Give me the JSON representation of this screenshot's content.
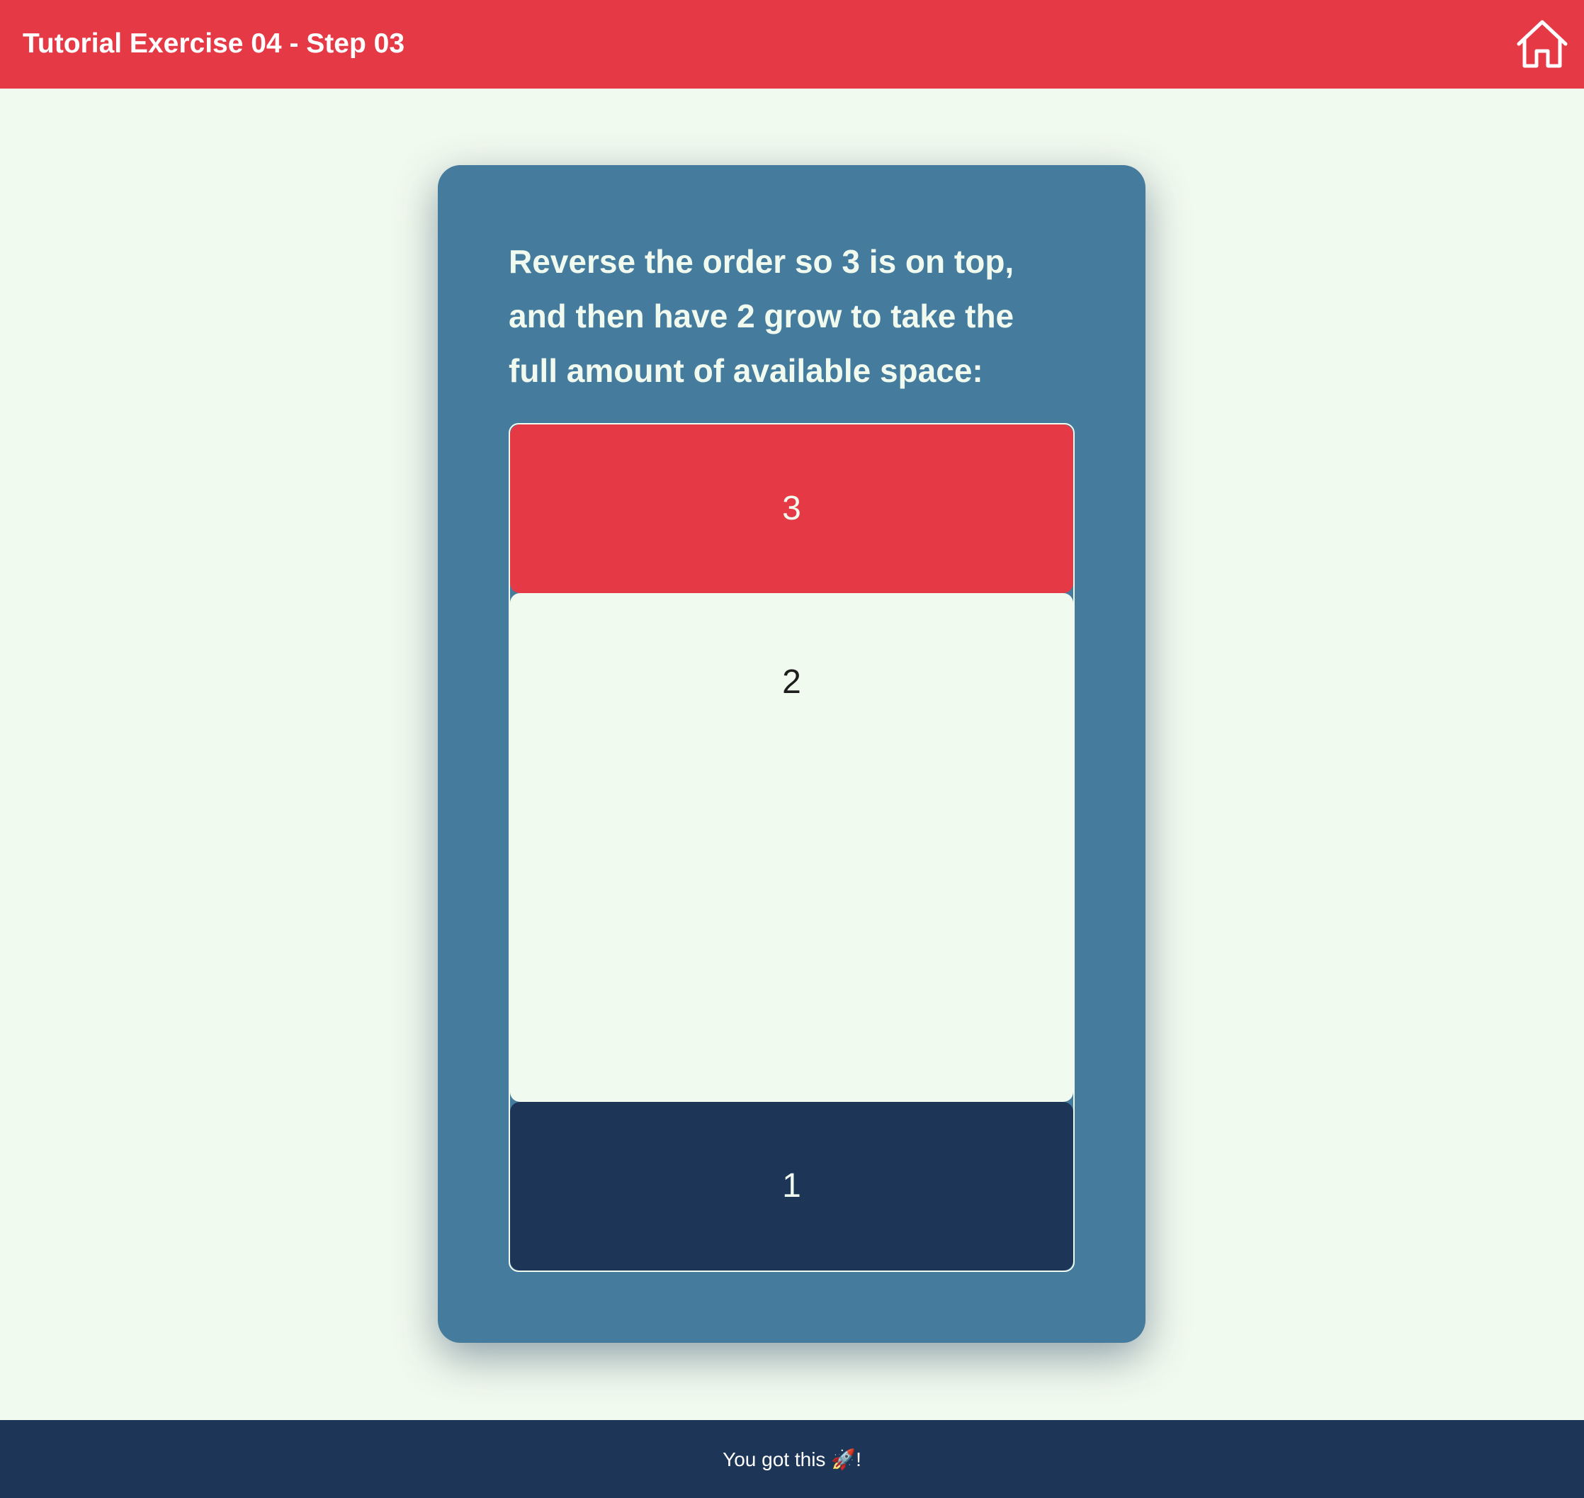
{
  "header": {
    "title": "Tutorial Exercise 04 - Step 03",
    "home_icon": "home-icon"
  },
  "card": {
    "instruction": "Reverse the order so 3 is on top, and then have 2 grow to take the full amount of available space:",
    "items": [
      {
        "label": "3",
        "color": "#e63946"
      },
      {
        "label": "2",
        "color": "#f1faee"
      },
      {
        "label": "1",
        "color": "#1d3557"
      }
    ]
  },
  "footer": {
    "text": "You got this 🚀!"
  },
  "colors": {
    "accent": "#e63946",
    "background": "#f1faee",
    "card": "#457b9d",
    "dark": "#1d3557"
  }
}
